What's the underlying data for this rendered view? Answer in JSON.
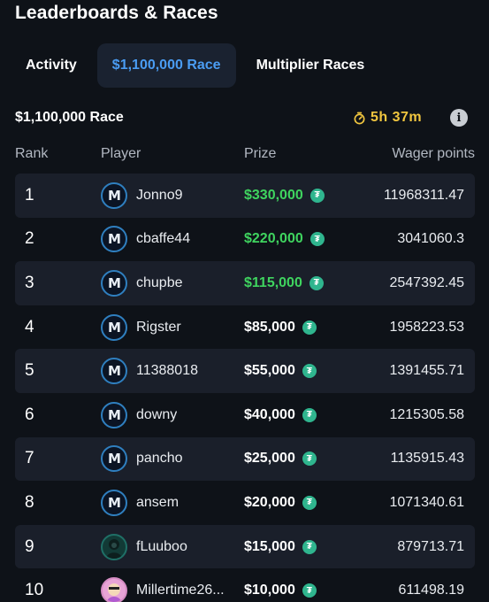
{
  "header": {
    "title": "Leaderboards & Races"
  },
  "tabs": [
    {
      "label": "Activity",
      "active": false
    },
    {
      "label": "$1,100,000 Race",
      "active": true
    },
    {
      "label": "Multiplier Races",
      "active": false
    }
  ],
  "race": {
    "title": "$1,100,000 Race",
    "timer": "5h 37m",
    "info_icon": "info-icon"
  },
  "columns": {
    "rank": "Rank",
    "player": "Player",
    "prize": "Prize",
    "wager": "Wager points"
  },
  "colors": {
    "accent": "#4a9cf2",
    "top_prize": "#3fd45f",
    "timer": "#f1c63f",
    "token": "#2fb58e"
  },
  "rows": [
    {
      "rank": "1",
      "player": "Jonno9",
      "prize": "$330,000",
      "wager": "11968311.47",
      "avatar": "logo"
    },
    {
      "rank": "2",
      "player": "cbaffe44",
      "prize": "$220,000",
      "wager": "3041060.3",
      "avatar": "logo"
    },
    {
      "rank": "3",
      "player": "chupbe",
      "prize": "$115,000",
      "wager": "2547392.45",
      "avatar": "logo"
    },
    {
      "rank": "4",
      "player": "Rigster",
      "prize": "$85,000",
      "wager": "1958223.53",
      "avatar": "logo"
    },
    {
      "rank": "5",
      "player": "11388018",
      "prize": "$55,000",
      "wager": "1391455.71",
      "avatar": "logo"
    },
    {
      "rank": "6",
      "player": "downy",
      "prize": "$40,000",
      "wager": "1215305.58",
      "avatar": "logo"
    },
    {
      "rank": "7",
      "player": "pancho",
      "prize": "$25,000",
      "wager": "1135915.43",
      "avatar": "logo"
    },
    {
      "rank": "8",
      "player": "ansem",
      "prize": "$20,000",
      "wager": "1071340.61",
      "avatar": "logo"
    },
    {
      "rank": "9",
      "player": "fLuuboo",
      "prize": "$15,000",
      "wager": "879713.71",
      "avatar": "hooded"
    },
    {
      "rank": "10",
      "player": "Millertime26...",
      "prize": "$10,000",
      "wager": "611498.19",
      "avatar": "pink"
    }
  ]
}
